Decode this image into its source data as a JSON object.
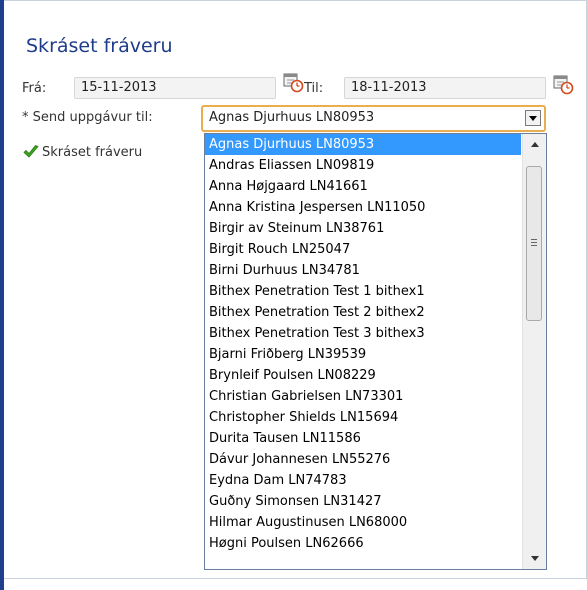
{
  "form": {
    "title": "Skráset fráveru",
    "from_label": "Frá:",
    "from_value": "15-11-2013",
    "to_label": "Til:",
    "to_value": "18-11-2013",
    "send_label": "* Send uppgávur til:",
    "send_selected": "Agnas Djurhuus LN80953",
    "status_text": "Skráset fráveru"
  },
  "icons": {
    "calendar": "calendar-clock-icon",
    "check": "checkmark-icon",
    "dropdown": "chevron-down-icon"
  },
  "colors": {
    "title": "#1e3c8a",
    "selected_bg": "#3399ff",
    "focus_border": "#e8ae4f",
    "check": "#3aa51f"
  },
  "dropdown": {
    "options": [
      "Agnas Djurhuus LN80953",
      "Andras Eliassen LN09819",
      "Anna Højgaard LN41661",
      "Anna Kristina Jespersen LN11050",
      "Birgir av Steinum LN38761",
      "Birgit Rouch LN25047",
      "Birni Durhuus LN34781",
      "Bithex Penetration Test 1 bithex1",
      "Bithex Penetration Test 2 bithex2",
      "Bithex Penetration Test 3 bithex3",
      "Bjarni Friðberg LN39539",
      "Brynleif Poulsen LN08229",
      "Christian Gabrielsen LN73301",
      "Christopher Shields LN15694",
      "Durita Tausen LN11586",
      "Dávur Johannesen LN55276",
      "Eydna Dam LN74783",
      "Guðny Simonsen LN31427",
      "Hilmar Augustinusen LN68000",
      "Høgni Poulsen LN62666"
    ]
  }
}
